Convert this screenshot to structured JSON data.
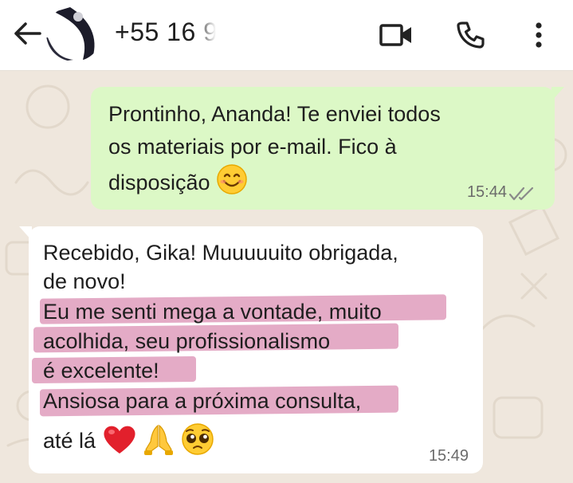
{
  "header": {
    "contact_name": "+55 16 9",
    "back_icon": "arrow-left-icon",
    "video_icon": "video-camera-icon",
    "call_icon": "phone-icon",
    "menu_icon": "more-vertical-icon"
  },
  "messages": [
    {
      "direction": "outgoing",
      "lines": [
        "Prontinho, Ananda! Te enviei todos",
        "os materiais por e-mail. Fico à",
        "disposição"
      ],
      "emoji": "smiling-face-icon",
      "time": "15:44",
      "status": "read-double-check-icon"
    },
    {
      "direction": "incoming",
      "lines": [
        "Recebido, Gika! Muuuuuito obrigada,",
        "de novo!",
        "Eu me senti mega a vontade, muito",
        "acolhida, seu profissionalismo",
        "é excelente!",
        "Ansiosa para a próxima consulta,",
        "até lá"
      ],
      "emojis": [
        "red-heart-icon",
        "folded-hands-icon",
        "pleading-face-icon"
      ],
      "time": "15:49"
    }
  ],
  "colors": {
    "outgoing_bubble": "#dcf8c6",
    "incoming_bubble": "#ffffff",
    "wallpaper": "#efe7dd",
    "highlight": "#d98bb0"
  }
}
